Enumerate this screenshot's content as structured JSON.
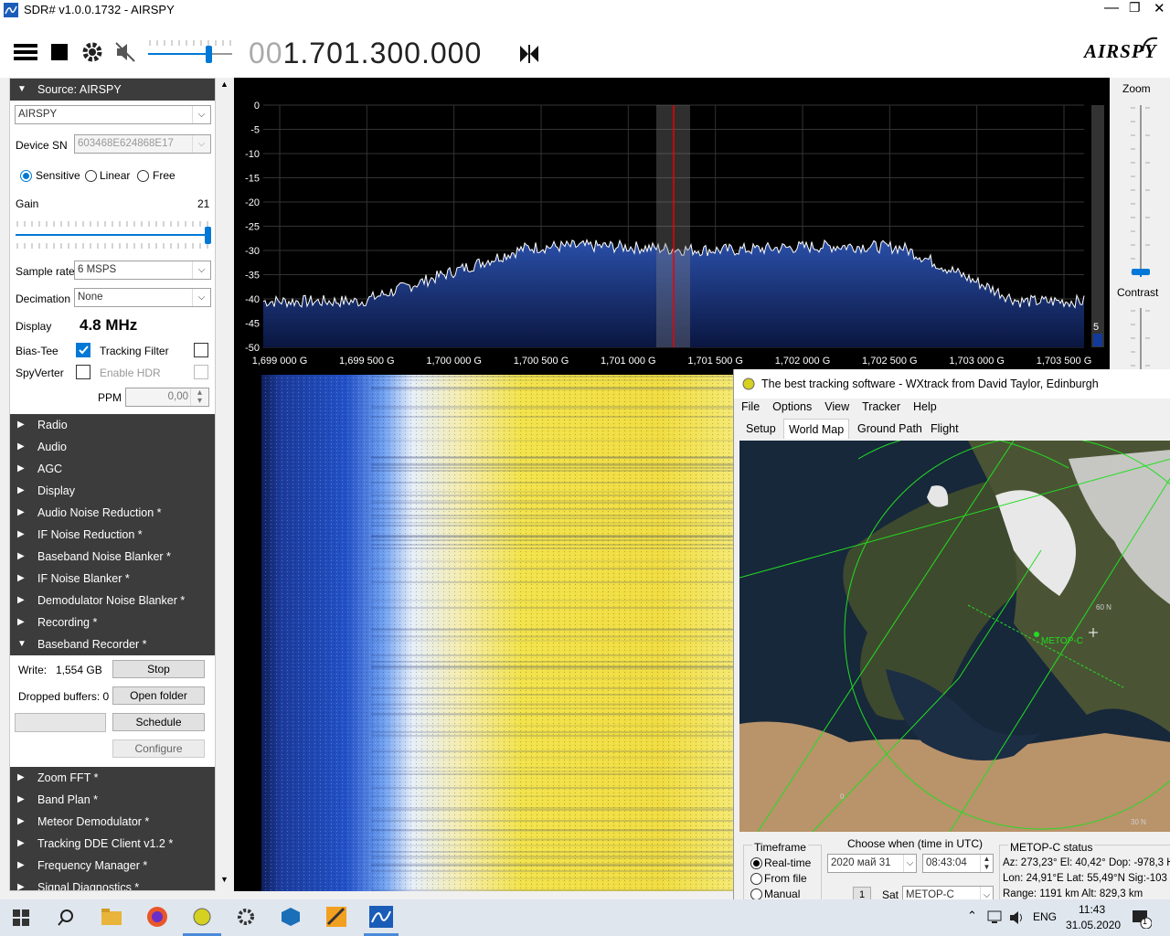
{
  "window": {
    "title": "SDR# v1.0.0.1732 - AIRSPY"
  },
  "toolbar": {
    "freq_dim": "00",
    "freq_main": "1.701.300.000",
    "logo": "AIRSPY"
  },
  "source": {
    "header": "Source: AIRSPY",
    "device": "AIRSPY",
    "device_sn_label": "Device SN",
    "device_sn": "603468E624868E17",
    "mode_sensitive": "Sensitive",
    "mode_linear": "Linear",
    "mode_free": "Free",
    "gain_label": "Gain",
    "gain_value": "21",
    "gain_fraction": 0.99,
    "sample_rate_label": "Sample rate",
    "sample_rate": "6 MSPS",
    "decimation_label": "Decimation",
    "decimation": "None",
    "display_label": "Display",
    "display_value": "4.8 MHz",
    "biastee_label": "Bias-Tee",
    "tracking_label": "Tracking Filter",
    "spyverter_label": "SpyVerter",
    "hdr_label": "Enable HDR",
    "ppm_label": "PPM",
    "ppm_value": "0,00"
  },
  "sections_top": [
    "Radio",
    "Audio",
    "AGC",
    "Display",
    "Audio Noise Reduction *",
    "IF Noise Reduction *",
    "Baseband Noise Blanker *",
    "IF Noise Blanker *",
    "Demodulator Noise Blanker *",
    "Recording *"
  ],
  "recorder": {
    "header": "Baseband Recorder *",
    "write_label": "Write:",
    "write_value": "1,554 GB",
    "stop": "Stop",
    "dropped_label": "Dropped buffers: 0",
    "open_folder": "Open folder",
    "schedule": "Schedule",
    "configure": "Configure"
  },
  "sections_bottom": [
    "Zoom FFT *",
    "Band Plan *",
    "Meteor Demodulator *",
    "Tracking DDE Client v1.2 *",
    "Frequency Manager *",
    "Signal Diagnostics *"
  ],
  "spectrum": {
    "y_ticks": [
      "0",
      "-5",
      "-10",
      "-15",
      "-20",
      "-25",
      "-30",
      "-35",
      "-40",
      "-45",
      "-50"
    ],
    "x_ticks": [
      "1,699 000 G",
      "1,699 500 G",
      "1,700 000 G",
      "1,700 500 G",
      "1,701 000 G",
      "1,701 500 G",
      "1,702 000 G",
      "1,702 500 G",
      "1,703 000 G",
      "1,703 500 G"
    ],
    "scale_value": "5"
  },
  "zoom": {
    "zoom_label": "Zoom",
    "contrast_label": "Contrast"
  },
  "wxtrack": {
    "title": "The best tracking software - WXtrack from David Taylor, Edinburgh",
    "menu": [
      "File",
      "Options",
      "View",
      "Tracker",
      "Help"
    ],
    "tabs": [
      "Setup",
      "World Map",
      "Ground Path",
      "Flight"
    ],
    "sat_label": "METOP-C",
    "lat_label": "60 N",
    "lon_label": "0",
    "lat2_label": "30 N",
    "timeframe_label": "Timeframe",
    "realtime": "Real-time",
    "fromfile": "From file",
    "manual": "Manual",
    "choose_label": "Choose when (time in UTC)",
    "date": "2020 май 31",
    "time": "08:43:04",
    "sat_num": "1",
    "sat_field_label": "Sat",
    "sat_value": "METOP-C",
    "status_title": "METOP-C status",
    "status_line1": "Az: 273,23°  El: 40,42°  Dop: -978,3 H",
    "status_line2": "Lon: 24,91°E  Lat: 55,49°N  Sig:-103",
    "status_line3": "Range: 1191 km  Alt: 829,3 km"
  },
  "taskbar": {
    "lang": "ENG",
    "time": "11:43",
    "date": "31.05.2020",
    "notif": "1"
  }
}
